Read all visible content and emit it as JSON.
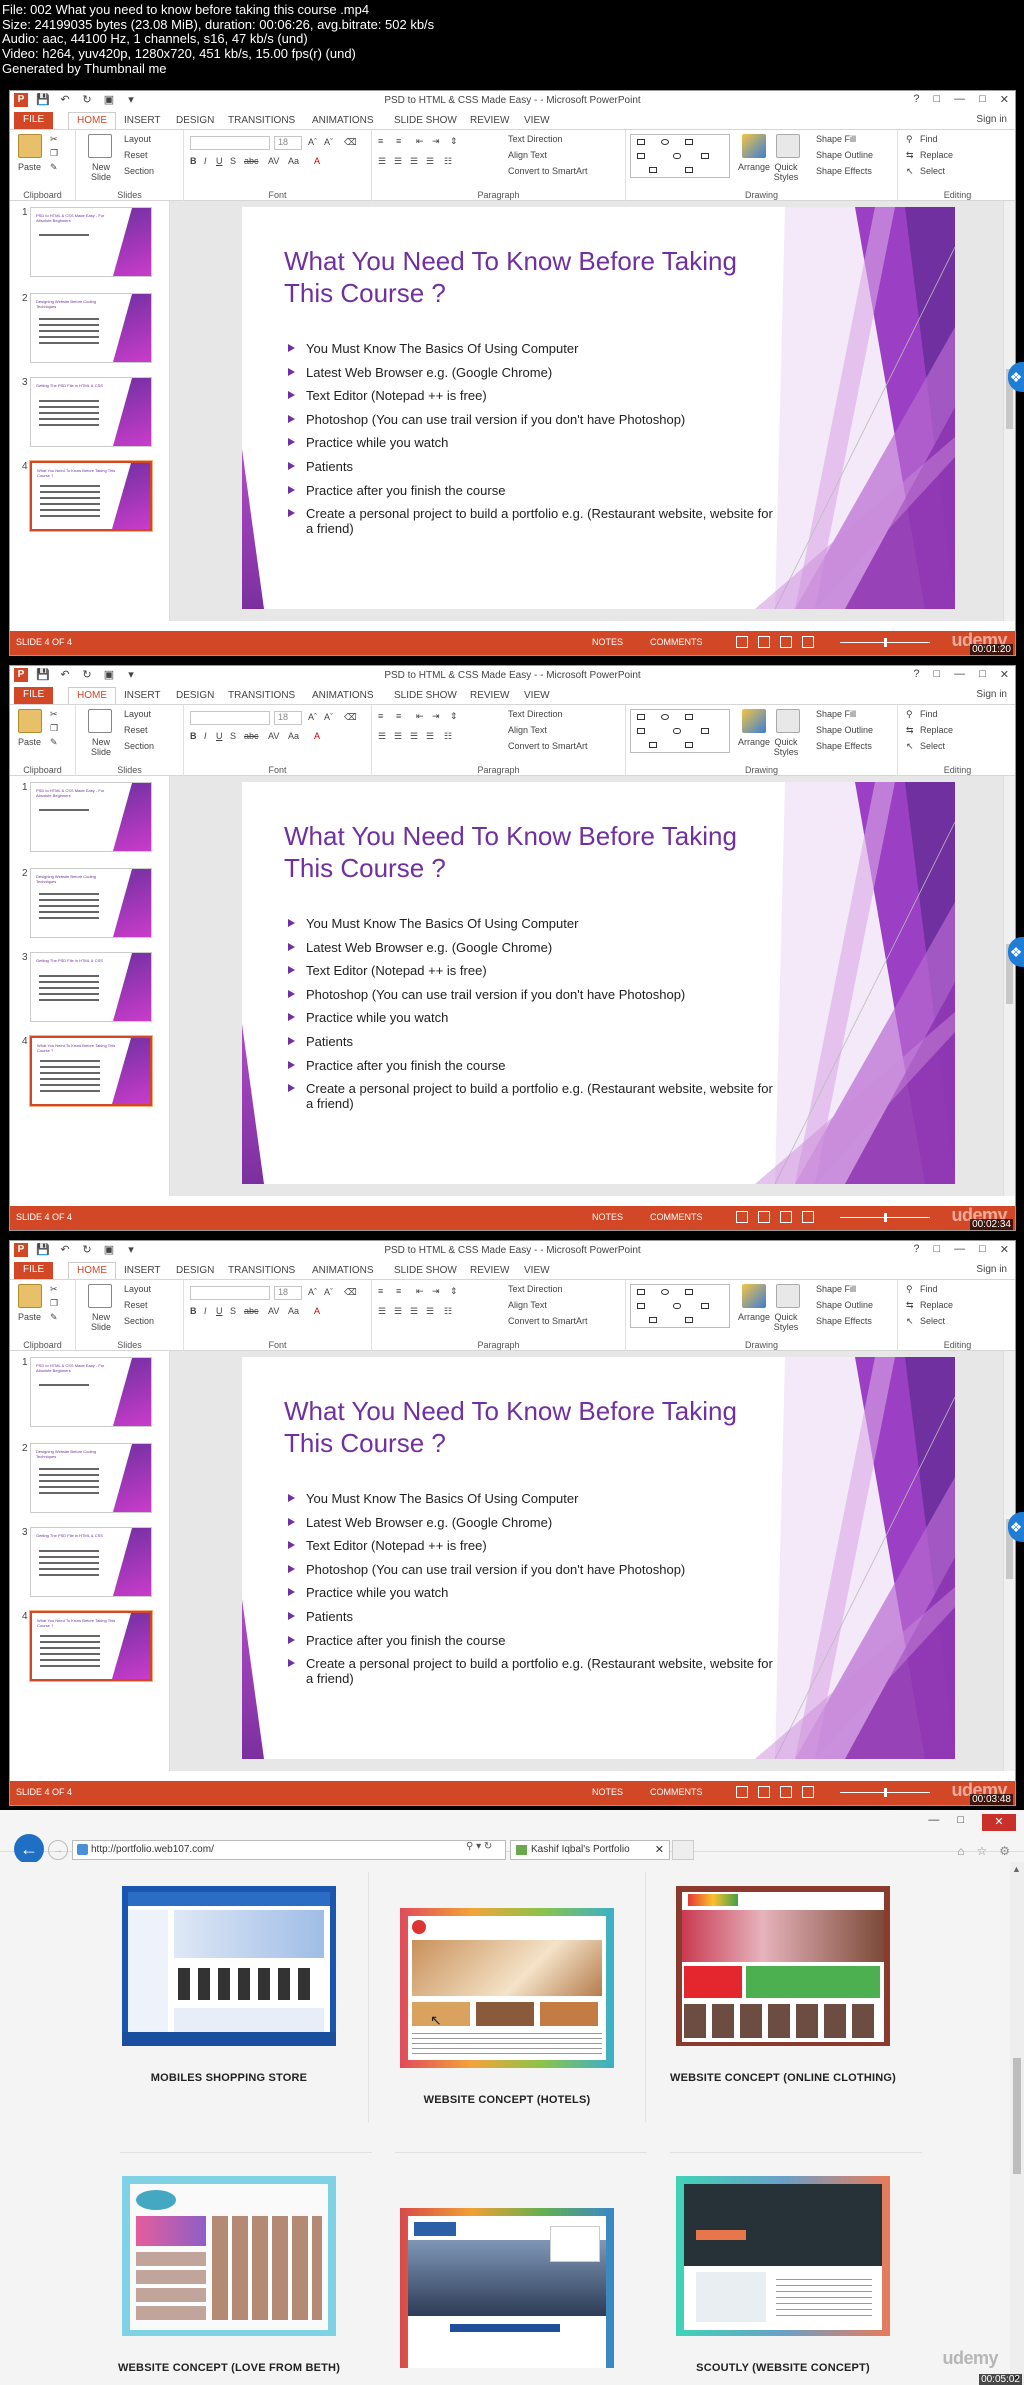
{
  "file_info": {
    "lines": [
      "File: 002 What you need to know before taking this course .mp4",
      "Size: 24199035 bytes (23.08 MiB), duration: 00:06:26, avg.bitrate: 502 kb/s",
      "Audio: aac, 44100 Hz, 1 channels, s16, 47 kb/s (und)",
      "Video: h264, yuv420p, 1280x720, 451 kb/s, 15.00 fps(r) (und)",
      "Generated by Thumbnail me"
    ]
  },
  "ppt": {
    "window_title": "PSD to HTML & CSS Made Easy - - Microsoft PowerPoint",
    "sign_in": "Sign in",
    "tabs": [
      "FILE",
      "HOME",
      "INSERT",
      "DESIGN",
      "TRANSITIONS",
      "ANIMATIONS",
      "SLIDE SHOW",
      "REVIEW",
      "VIEW"
    ],
    "ribbon": {
      "paste": "Paste",
      "new_slide": "New Slide",
      "layout": "Layout",
      "reset": "Reset",
      "section": "Section",
      "font_size": "18",
      "text_direction": "Text Direction",
      "align_text": "Align Text",
      "convert_smartart": "Convert to SmartArt",
      "arrange": "Arrange",
      "quick_styles": "Quick Styles",
      "shape_fill": "Shape Fill",
      "shape_outline": "Shape Outline",
      "shape_effects": "Shape Effects",
      "find": "Find",
      "replace": "Replace",
      "select": "Select",
      "groups": [
        "Clipboard",
        "Slides",
        "Font",
        "Paragraph",
        "Drawing",
        "Editing"
      ]
    },
    "thumbnails": [
      {
        "num": "1",
        "title": "PSD to HTML & CSS Made Easy - For Absolute Beginners"
      },
      {
        "num": "2",
        "title": "Designing Website Before Coding Techniques"
      },
      {
        "num": "3",
        "title": "Getting The PSD File in HTML & CSS"
      },
      {
        "num": "4",
        "title": "What You Need To Know Before Taking This Course ?"
      }
    ],
    "slide": {
      "title": "What You Need To Know Before Taking This Course ?",
      "bullets": [
        "You Must Know The Basics Of Using Computer",
        "Latest Web Browser e.g. (Google Chrome)",
        "Text Editor (Notepad ++ is free)",
        "Photoshop (You can use trail version if you don't have Photoshop)",
        "Practice while you watch",
        "Patients",
        "Practice after you finish the course",
        "Create a personal project to build a portfolio e.g. (Restaurant website, website for a friend)"
      ]
    },
    "status": {
      "slide_no": "SLIDE 4 OF 4",
      "notes": "NOTES",
      "comments": "COMMENTS",
      "zoom": "74%"
    },
    "watermark": "udemy",
    "timestamps": [
      "00:01:20",
      "00:02:34",
      "00:03:48"
    ]
  },
  "browser": {
    "url": "http://portfolio.web107.com/",
    "tab_title": "Kashif Iqbal's Portfolio",
    "watermark": "udemy",
    "timestamp": "00:05:02",
    "cards": [
      {
        "label": "MOBILES SHOPPING STORE"
      },
      {
        "label": "WEBSITE CONCEPT (HOTELS)"
      },
      {
        "label": "WEBSITE CONCEPT (ONLINE CLOTHING)"
      },
      {
        "label": "WEBSITE CONCEPT (LOVE FROM BETH)"
      },
      {
        "label": ""
      },
      {
        "label": "SCOUTLY (WEBSITE CONCEPT)"
      }
    ]
  },
  "colors": {
    "accent": "#d24726",
    "title_purple": "#7030a0",
    "browser_blue": "#1f6fc5"
  }
}
